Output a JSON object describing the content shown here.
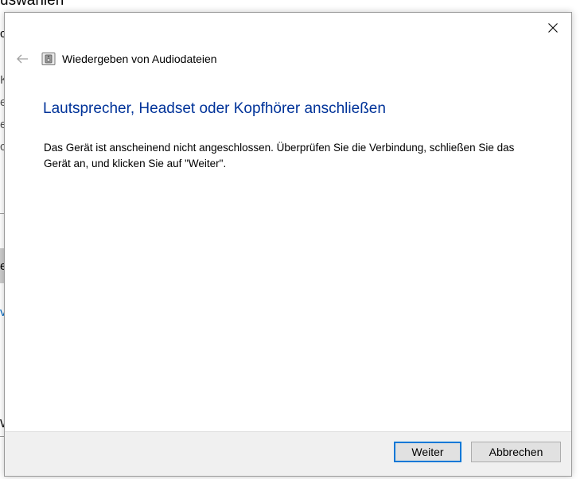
{
  "background": {
    "title": "uswählen",
    "fragments": [
      "c",
      "K",
      "e",
      "e",
      "c",
      "e",
      "va",
      "W"
    ]
  },
  "dialog": {
    "header_title": "Wiedergeben von Audiodateien",
    "heading": "Lautsprecher, Headset oder Kopfhörer anschließen",
    "message": "Das Gerät ist anscheinend nicht angeschlossen. Überprüfen Sie die Verbindung, schließen Sie das Gerät an, und klicken Sie auf \"Weiter\".",
    "icons": {
      "close": "close-icon",
      "back": "back-arrow-icon",
      "wizard": "speaker-icon"
    }
  },
  "footer": {
    "next_label": "Weiter",
    "cancel_label": "Abbrechen"
  },
  "colors": {
    "heading": "#003399",
    "accent": "#0078d7",
    "footer_bg": "#f0f0f0"
  }
}
